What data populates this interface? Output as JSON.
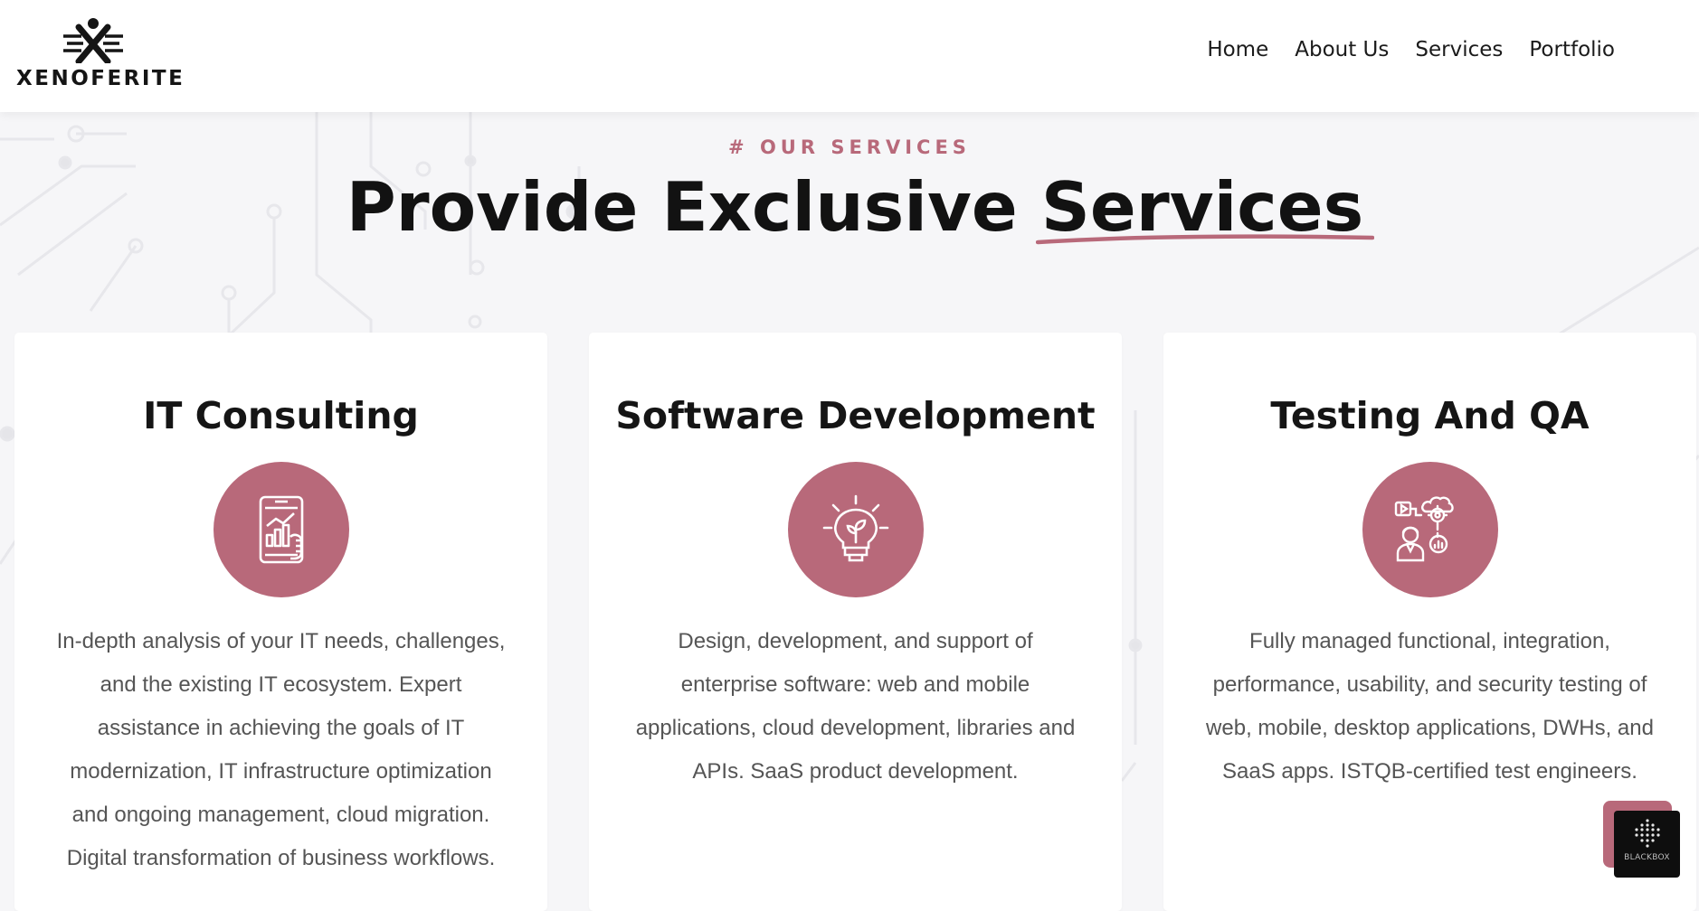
{
  "header": {
    "logo_text": "XENOFERITE",
    "nav": [
      "Home",
      "About Us",
      "Services",
      "Portfolio"
    ]
  },
  "services_section": {
    "tag": "# OUR SERVICES",
    "title_plain": "Provide Exclusive ",
    "title_highlight": "Services",
    "cards": [
      {
        "title": "IT Consulting",
        "icon": "mobile-analytics-icon",
        "description": "In-depth analysis of your IT needs, challenges, and the existing IT ecosystem. Expert assistance in achieving the goals of IT modernization, IT infrastructure optimization and ongoing management, cloud migration. Digital transformation of business workflows."
      },
      {
        "title": "Software Development",
        "icon": "lightbulb-icon",
        "description": "Design, development, and support of enterprise software: web and mobile applications, cloud development, libraries and APIs. SaaS product development."
      },
      {
        "title": "Testing And QA",
        "icon": "tester-workflow-icon",
        "description": "Fully managed functional, integration, performance, usability, and security testing of web, mobile, desktop applications, DWHs, and SaaS apps. ISTQB-certified test engineers."
      }
    ]
  },
  "widget": {
    "label": "BLACKBOX"
  },
  "colors": {
    "accent": "#b8697a",
    "heading": "#121212",
    "body_text": "#555555",
    "background": "#f6f6f8"
  }
}
